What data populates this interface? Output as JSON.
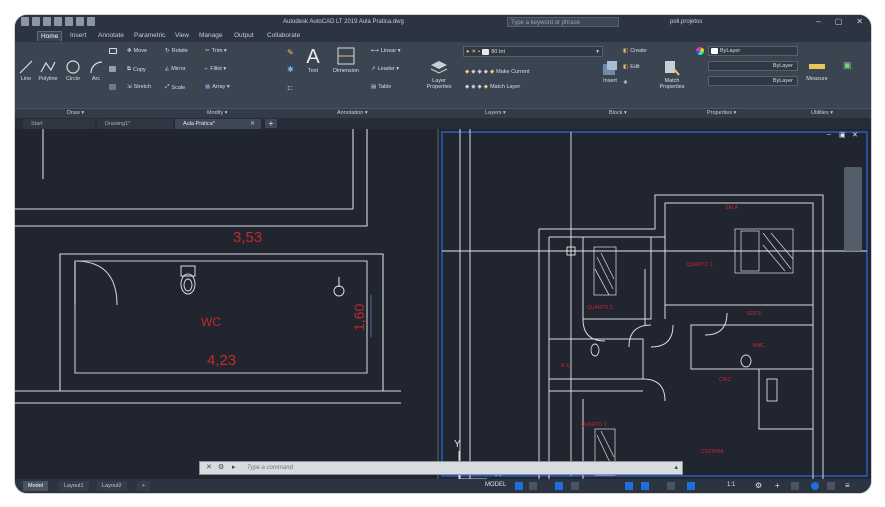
{
  "titlebar": {
    "title": "Autodesk AutoCAD LT 2019   Aula Pratica.dwg",
    "search_placeholder": "Type a keyword or phrase",
    "user_label": "poli.projetos"
  },
  "menu_tabs": [
    "Home",
    "Insert",
    "Annotate",
    "Parametric",
    "View",
    "Manage",
    "Output",
    "Collaborate"
  ],
  "ribbon": {
    "draw": {
      "line": "Line",
      "polyline": "Polyline",
      "circle": "Circle",
      "arc": "Arc",
      "panel": "Draw ▾"
    },
    "modify": {
      "move": "Move",
      "rotate": "Rotate",
      "trim": "Trim ▾",
      "copy": "Copy",
      "mirror": "Mirror",
      "fillet": "Fillet ▾",
      "stretch": "Stretch",
      "scale": "Scale",
      "array": "Array ▾",
      "panel": "Modify ▾"
    },
    "annotation": {
      "text": "Text",
      "dimension": "Dimension",
      "linear": "Linear ▾",
      "leader": "Leader ▾",
      "table": "Table",
      "panel": "Annotation ▾"
    },
    "layers": {
      "layer_properties": "Layer Properties",
      "layer_name": "80 Int",
      "make_current": "Make Current",
      "match_layer": "Match Layer",
      "panel": "Layers ▾"
    },
    "block": {
      "insert": "Insert",
      "create": "Create",
      "edit": "Edit",
      "panel": "Block ▾"
    },
    "properties": {
      "match": "Match Properties",
      "bylayer1": "ByLayer",
      "bylayer2": "ByLayer",
      "bylayer3": "ByLayer",
      "panel": "Properties ▾"
    },
    "utilities": {
      "measure": "Measure",
      "panel": "Utilities ▾"
    }
  },
  "doc_tabs": [
    {
      "label": "Start"
    },
    {
      "label": "Drawing1*"
    },
    {
      "label": "Aula Prática*"
    }
  ],
  "drawing": {
    "dim_top": "3,53",
    "room_wc": "WC",
    "dim_bottom": "4,23",
    "dim_right": "1,60",
    "plan_labels": [
      "SALA",
      "QUARTO 1",
      "QUARTO 2",
      "QUARTO 3",
      "BWC",
      "SUITE",
      "COZINHA",
      "CIRC",
      "A.S."
    ],
    "axis_y": "Y",
    "axis_x": "X"
  },
  "command": {
    "placeholder": "Type a command"
  },
  "status": {
    "model": "MODEL",
    "scale": "1:1"
  },
  "layout_tabs": [
    "Model",
    "Layout1",
    "Layout2"
  ],
  "colors": {
    "accent": "#1e6fd9",
    "drawing_red": "#c8282b",
    "canvas": "#20252f"
  }
}
